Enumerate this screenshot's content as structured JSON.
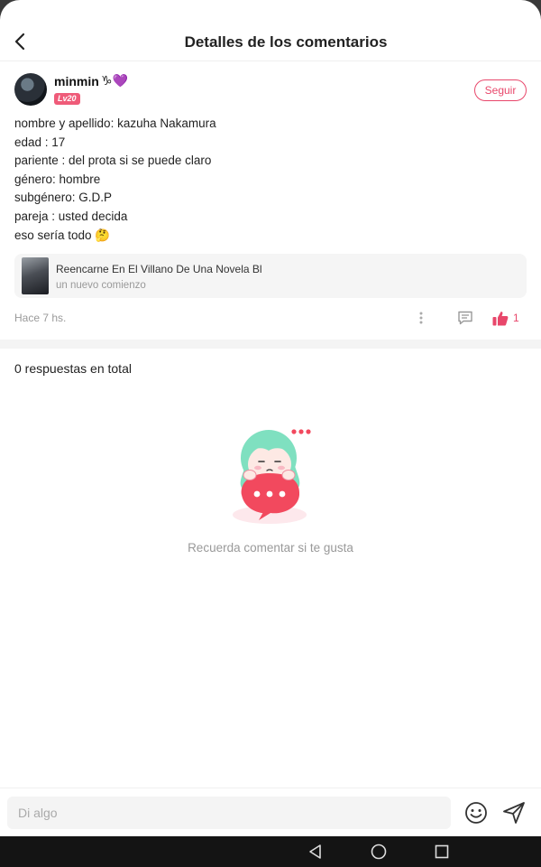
{
  "header": {
    "title": "Detalles de los comentarios"
  },
  "author": {
    "name": "minmin",
    "badges": "♑💜",
    "level": "Lv20",
    "follow_label": "Seguir"
  },
  "comment": {
    "lines": [
      "nombre y apellido: kazuha Nakamura",
      "edad : 17",
      "pariente : del prota si se puede claro",
      "género: hombre",
      "subgénero: G.D.P",
      "pareja : usted decida",
      "eso sería todo 🤔"
    ],
    "time": "Hace 7 hs.",
    "likes": "1"
  },
  "work": {
    "title": "Reencarne En El Villano De Una Novela Bl",
    "subtitle": "un nuevo comienzo"
  },
  "replies": {
    "total_label": "0 respuestas en total",
    "empty_message": "Recuerda comentar si te gusta"
  },
  "footer": {
    "input_placeholder": "Di algo"
  },
  "colors": {
    "accent": "#e8476b",
    "level_badge": "#ef5b79",
    "mascot_hair": "#7fe0c0",
    "mascot_bubble": "#f2495e"
  },
  "icons": [
    "back-arrow-icon",
    "more-vertical-icon",
    "comment-icon",
    "thumbs-up-icon",
    "emoji-icon",
    "send-icon"
  ]
}
